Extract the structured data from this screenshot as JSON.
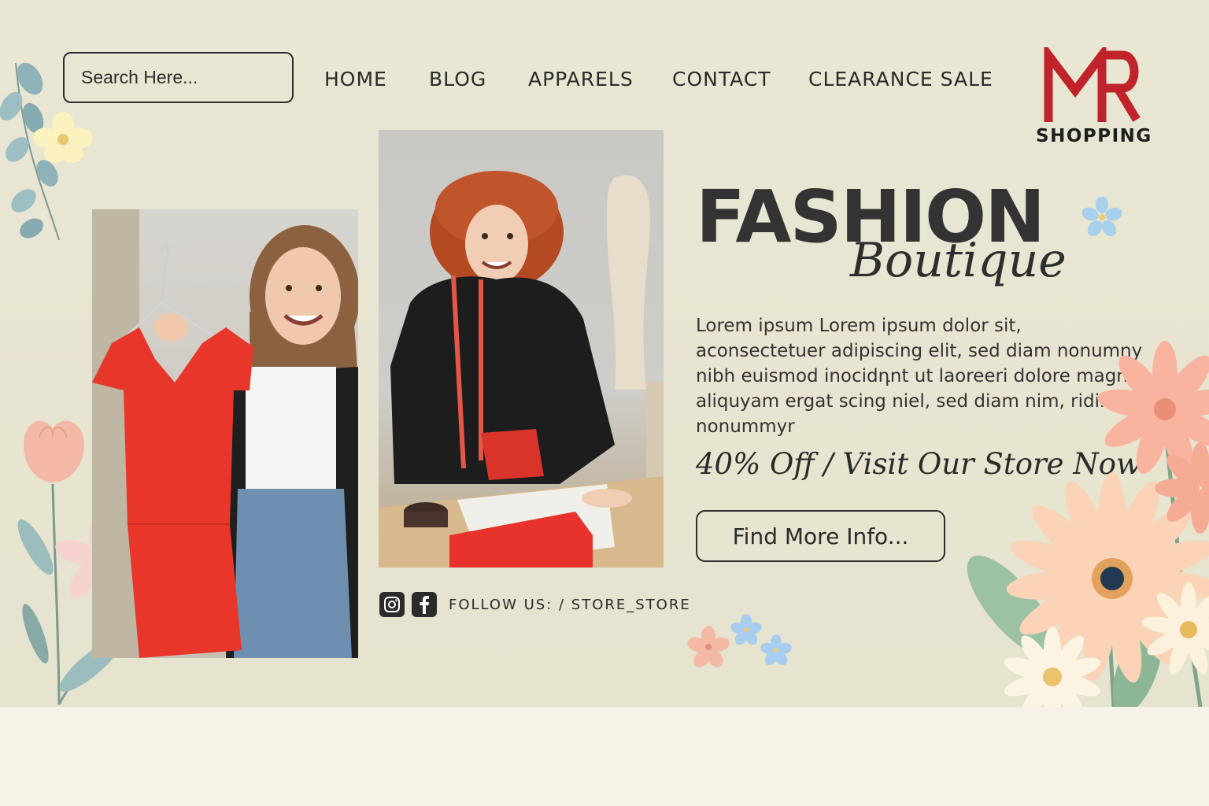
{
  "search": {
    "placeholder": "Search Here..."
  },
  "nav": {
    "items": [
      {
        "label": "HOME"
      },
      {
        "label": "BLOG"
      },
      {
        "label": "APPARELS"
      },
      {
        "label": "CONTACT"
      },
      {
        "label": "CLEARANCE SALE"
      }
    ]
  },
  "logo": {
    "text": "SHOPPING",
    "color": "#c0232a"
  },
  "hero": {
    "title": "FASHION",
    "subtitle": "Boutique",
    "body": "Lorem ipsum Lorem ipsum dolor sit, aconsectetuer adipiscing elit, sed diam nonumny nibh euismod inocidդnt ut laoreeri dolore magna aliquyam ergat scing niel, sed diam nim, ridini nonummyr",
    "promo": "40% Off / Visit Our Store Now",
    "cta_label": "Find More Info..."
  },
  "social": {
    "icons": [
      "instagram-icon",
      "facebook-icon"
    ],
    "follow_text": "FOLLOW US: / STORE_STORE"
  },
  "colors": {
    "background": "#e8e5d1",
    "text": "#2b2b2b",
    "accent_red": "#e8362b"
  }
}
